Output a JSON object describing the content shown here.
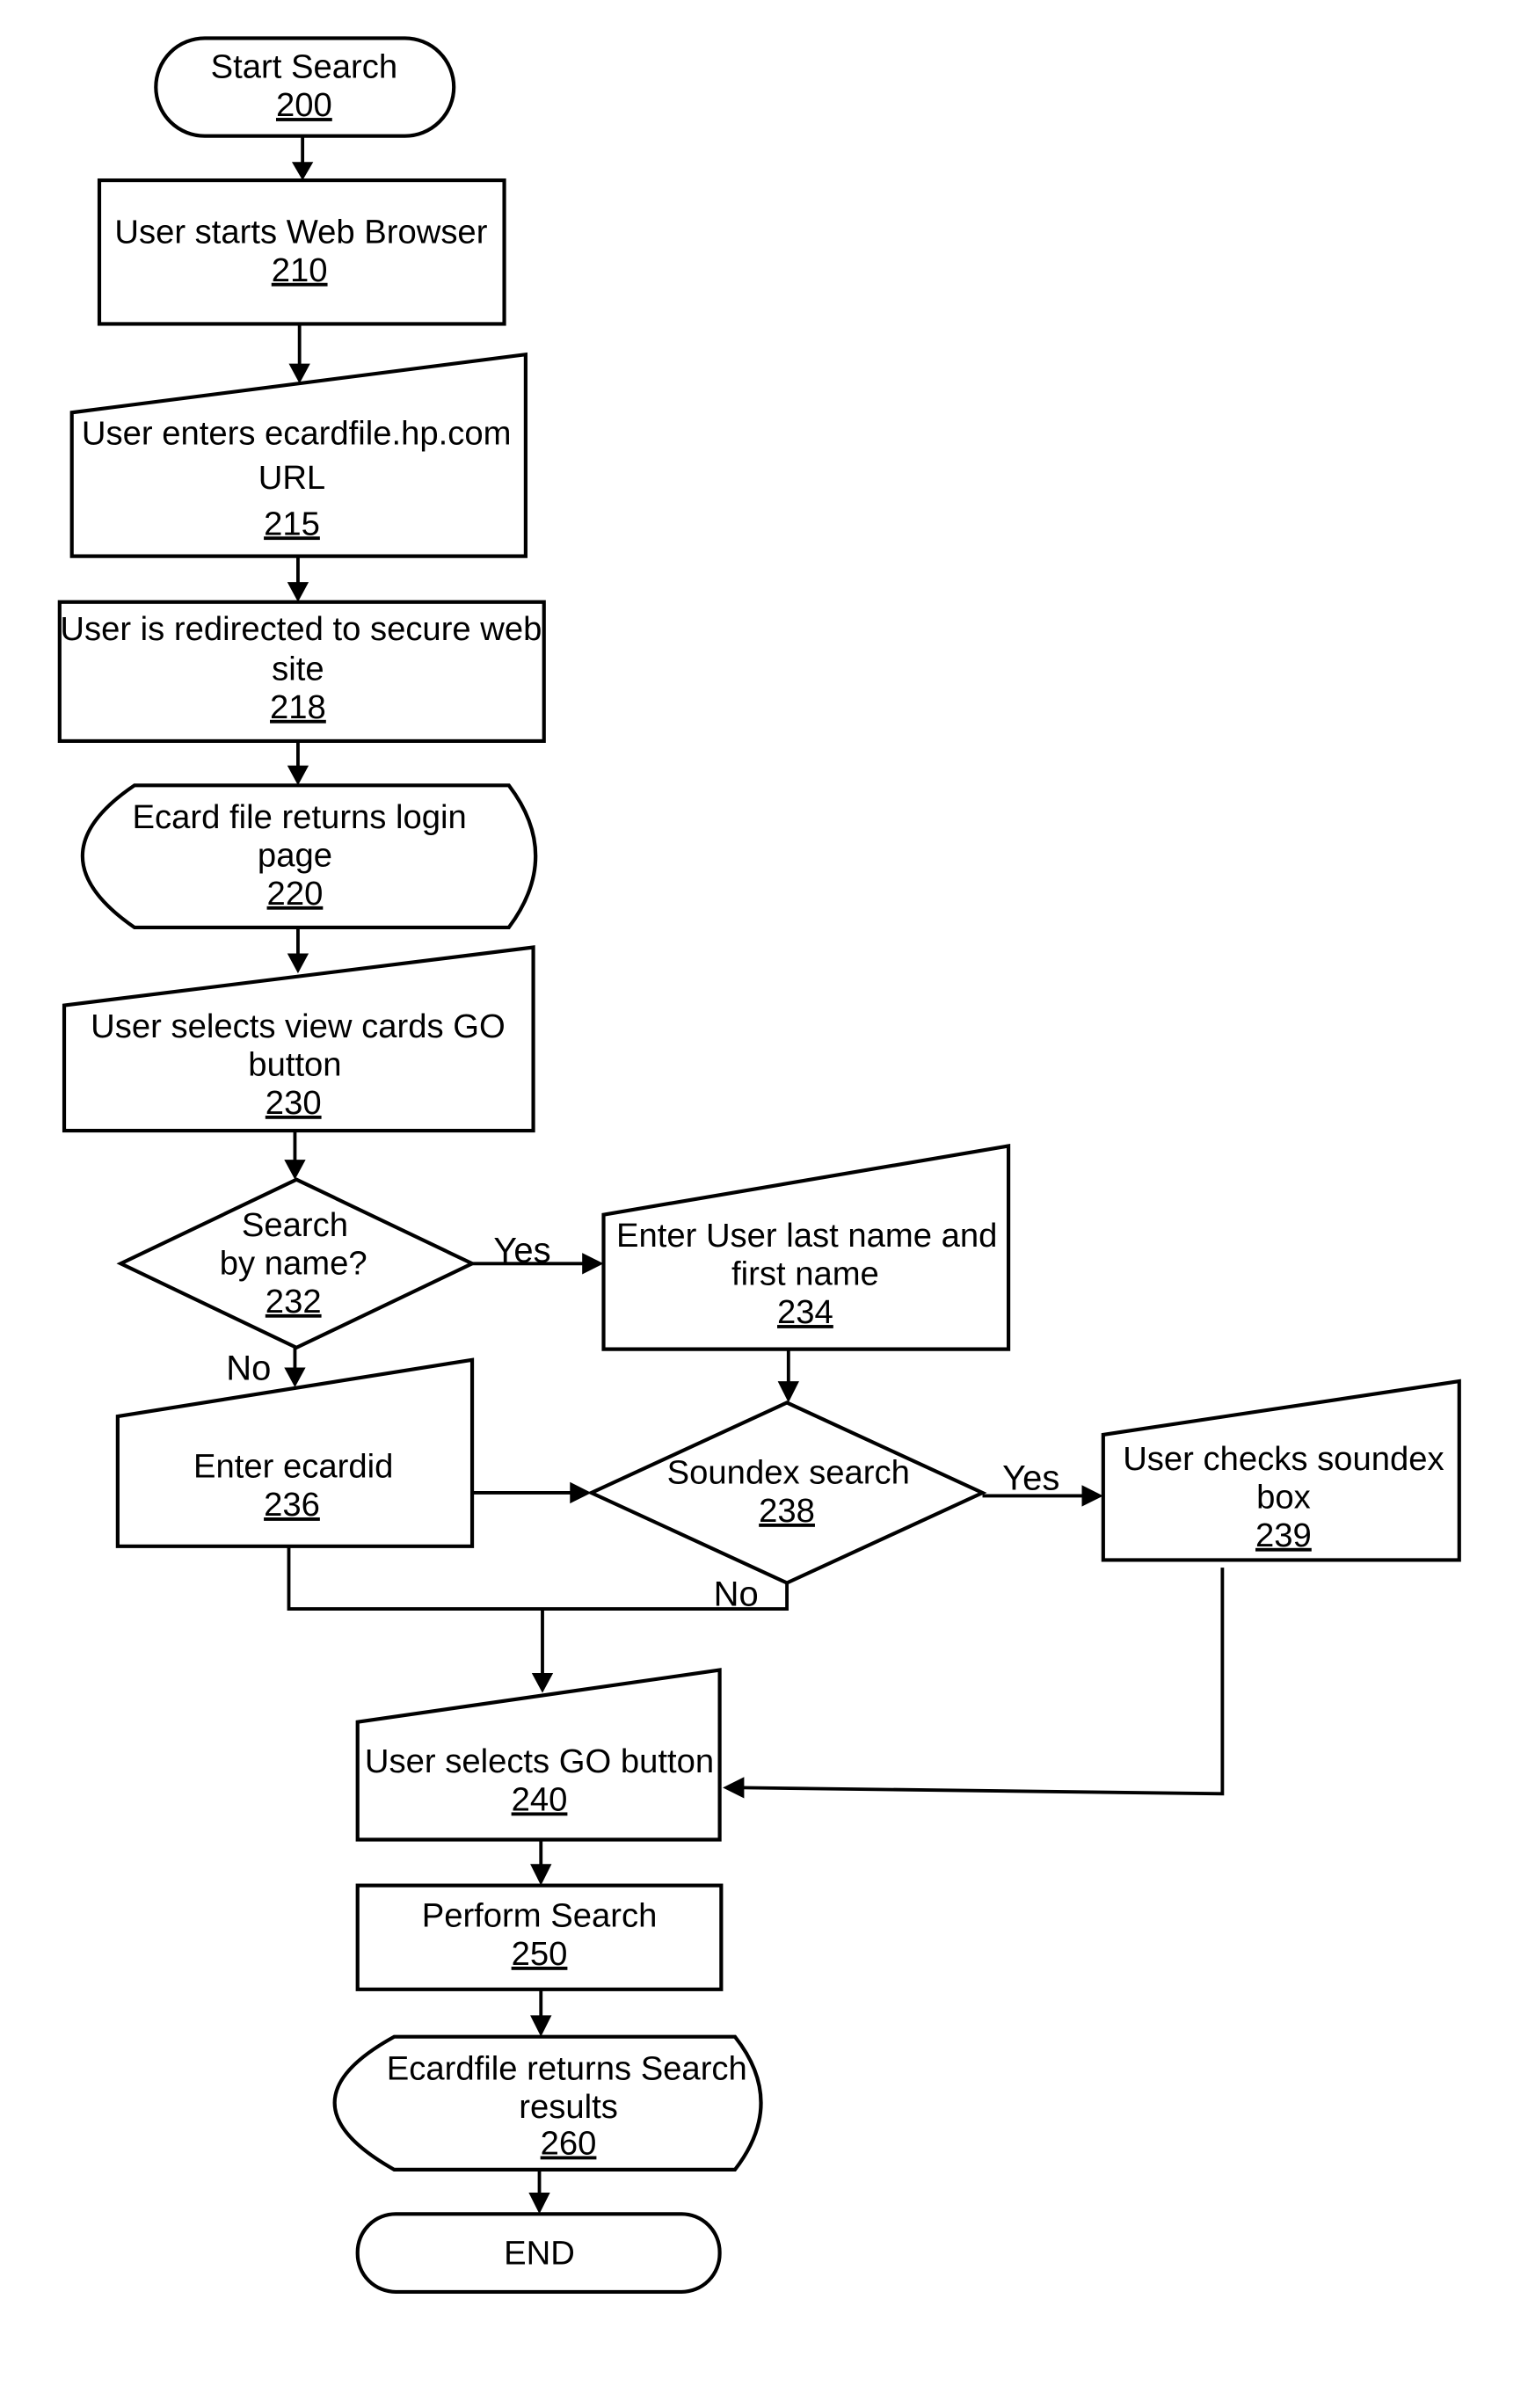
{
  "diagram": {
    "type": "flowchart",
    "nodes": {
      "n200": {
        "shape": "terminal",
        "lines": [
          "Start Search"
        ],
        "ref": "200"
      },
      "n210": {
        "shape": "process",
        "lines": [
          "User starts Web Browser"
        ],
        "ref": "210"
      },
      "n215": {
        "shape": "manual-input",
        "lines": [
          "User enters ecardfile.hp.com",
          "URL"
        ],
        "ref": "215"
      },
      "n218": {
        "shape": "process",
        "lines": [
          "User is redirected to secure web",
          "site"
        ],
        "ref": "218"
      },
      "n220": {
        "shape": "display",
        "lines": [
          "Ecard file returns login",
          "page"
        ],
        "ref": "220"
      },
      "n230": {
        "shape": "manual-input",
        "lines": [
          "User selects view cards GO",
          "button"
        ],
        "ref": "230"
      },
      "n232": {
        "shape": "decision",
        "lines": [
          "Search",
          "by name?"
        ],
        "ref": "232"
      },
      "n234": {
        "shape": "manual-input",
        "lines": [
          "Enter User last name and",
          "first name"
        ],
        "ref": "234"
      },
      "n236": {
        "shape": "manual-input",
        "lines": [
          "Enter ecardid"
        ],
        "ref": "236"
      },
      "n238": {
        "shape": "decision",
        "lines": [
          "Soundex search"
        ],
        "ref": "238"
      },
      "n239": {
        "shape": "manual-input",
        "lines": [
          "User checks soundex",
          "box"
        ],
        "ref": "239"
      },
      "n240": {
        "shape": "manual-input",
        "lines": [
          "User selects GO button"
        ],
        "ref": "240"
      },
      "n250": {
        "shape": "process",
        "lines": [
          "Perform Search"
        ],
        "ref": "250"
      },
      "n260": {
        "shape": "display",
        "lines": [
          "Ecardfile returns Search",
          "results"
        ],
        "ref": "260"
      },
      "end": {
        "shape": "terminal",
        "lines": [
          "END"
        ],
        "ref": ""
      }
    },
    "edges": [
      {
        "from": "200",
        "to": "210",
        "label": ""
      },
      {
        "from": "210",
        "to": "215",
        "label": ""
      },
      {
        "from": "215",
        "to": "218",
        "label": ""
      },
      {
        "from": "218",
        "to": "220",
        "label": ""
      },
      {
        "from": "220",
        "to": "230",
        "label": ""
      },
      {
        "from": "230",
        "to": "232",
        "label": ""
      },
      {
        "from": "232",
        "to": "234",
        "label": "Yes"
      },
      {
        "from": "232",
        "to": "236",
        "label": "No"
      },
      {
        "from": "234",
        "to": "238",
        "label": ""
      },
      {
        "from": "236",
        "to": "238",
        "label": ""
      },
      {
        "from": "238",
        "to": "239",
        "label": "Yes"
      },
      {
        "from": "238",
        "to": "240",
        "label": "No"
      },
      {
        "from": "236",
        "to": "240",
        "label": ""
      },
      {
        "from": "239",
        "to": "240",
        "label": ""
      },
      {
        "from": "240",
        "to": "250",
        "label": ""
      },
      {
        "from": "250",
        "to": "260",
        "label": ""
      },
      {
        "from": "260",
        "to": "END",
        "label": ""
      }
    ],
    "branch_labels": {
      "yes_232": "Yes",
      "no_232": "No",
      "yes_238": "Yes",
      "no_238": "No"
    }
  }
}
